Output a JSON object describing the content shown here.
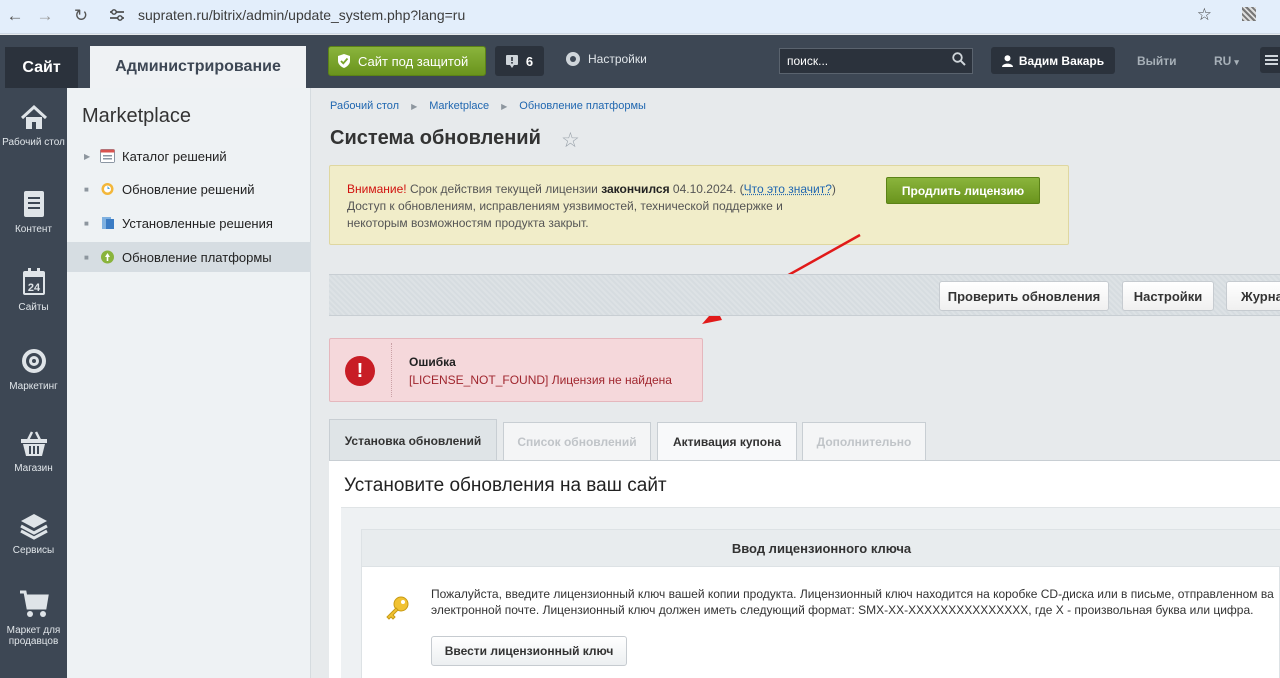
{
  "browser": {
    "url": "supraten.ru/bitrix/admin/update_system.php?lang=ru"
  },
  "topbar": {
    "site_tab": "Сайт",
    "admin_tab": "Администрирование",
    "protect_button": "Сайт под защитой",
    "notifications_count": "6",
    "settings": "Настройки",
    "search_placeholder": "поиск...",
    "user_name": "Вадим Вакарь",
    "logout": "Выйти",
    "lang": "RU"
  },
  "iconbar": {
    "items": [
      {
        "label": "Рабочий стол",
        "icon": "home-icon"
      },
      {
        "label": "Контент",
        "icon": "document-icon"
      },
      {
        "label": "Сайты",
        "icon": "calendar-icon"
      },
      {
        "label": "Маркетинг",
        "icon": "target-icon"
      },
      {
        "label": "Магазин",
        "icon": "basket-icon"
      },
      {
        "label": "Сервисы",
        "icon": "layers-icon"
      },
      {
        "label": "Маркет для продавцов",
        "icon": "cart-icon"
      }
    ]
  },
  "menu": {
    "title": "Marketplace",
    "items": [
      {
        "label": "Каталог решений"
      },
      {
        "label": "Обновление решений"
      },
      {
        "label": "Установленные решения"
      },
      {
        "label": "Обновление платформы",
        "active": true
      }
    ]
  },
  "breadcrumbs": [
    "Рабочий стол",
    "Marketplace",
    "Обновление платформы"
  ],
  "page_title": "Система обновлений",
  "warning": {
    "prefix": "Внимание!",
    "text1": " Срок действия текущей лицензии ",
    "bold": "закончился",
    "text2": " 04.10.2024. (",
    "link": "Что это значит?",
    "text3": ")",
    "line2": "Доступ к обновлениям, исправлениям уязвимостей, технической поддержке и",
    "line3": "некоторым возможностям продукта закрыт.",
    "button": "Продлить лицензию"
  },
  "toolbar": {
    "check_updates": "Проверить обновления",
    "settings": "Настройки",
    "journal": "Журна"
  },
  "error": {
    "title": "Ошибка",
    "message": "[LICENSE_NOT_FOUND] Лицензия не найдена"
  },
  "tabs": [
    {
      "label": "Установка обновлений",
      "state": "active"
    },
    {
      "label": "Список обновлений",
      "state": "disabled"
    },
    {
      "label": "Активация купона",
      "state": "normal"
    },
    {
      "label": "Дополнительно",
      "state": "disabled"
    }
  ],
  "content": {
    "title": "Установите обновления на ваш сайт",
    "box_title": "Ввод лицензионного ключа",
    "line1": "Пожалуйста, введите лицензионный ключ вашей копии продукта. Лицензионный ключ находится на коробке CD-диска или в письме, отправленном ва",
    "line2": "электронной почте. Лицензионный ключ должен иметь следующий формат: SMX-XX-XXXXXXXXXXXXXXX, где X - произвольная буква или цифра.",
    "button": "Ввести лицензионный ключ"
  },
  "colors": {
    "accent_green": "#7aa42b",
    "error_red": "#c81d25",
    "link_blue": "#2067b0"
  }
}
